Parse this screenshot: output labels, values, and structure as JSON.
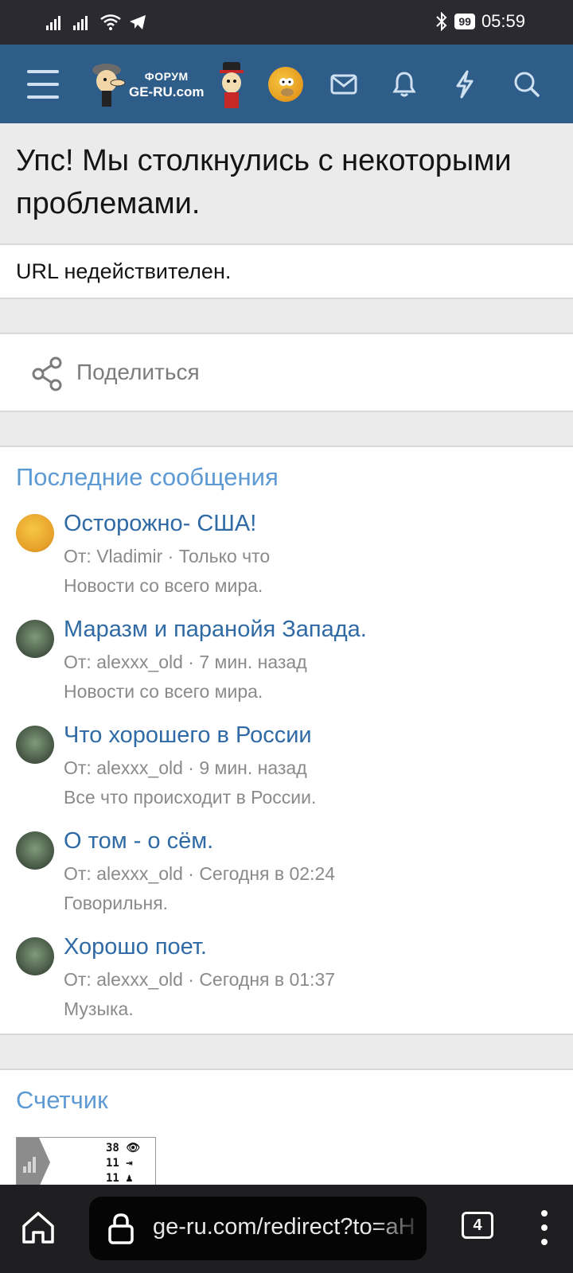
{
  "status_bar": {
    "battery": "99",
    "time": "05:59"
  },
  "header": {
    "logo_line1": "ФОРУМ",
    "logo_line2": "GE-RU.com"
  },
  "error": {
    "title": "Упс! Мы столкнулись с некоторыми проблемами.",
    "message": "URL недействителен."
  },
  "share": {
    "label": "Поделиться"
  },
  "recent": {
    "title": "Последние сообщения",
    "posts": [
      {
        "title": "Осторожно- США!",
        "meta": "От: Vladimir · Только что",
        "forum": "Новости со всего мира.",
        "avatar": "homer"
      },
      {
        "title": "Маразм и паранойя Запада.",
        "meta": "От: alexxx_old · 7 мин. назад",
        "forum": "Новости со всего мира.",
        "avatar": "old"
      },
      {
        "title": "Что хорошего в России",
        "meta": "От: alexxx_old · 9 мин. назад",
        "forum": "Все что происходит в России.",
        "avatar": "old"
      },
      {
        "title": "О том - о сём.",
        "meta": "От: alexxx_old · Сегодня в 02:24",
        "forum": "Говорильня.",
        "avatar": "old"
      },
      {
        "title": "Хорошо поет.",
        "meta": "От: alexxx_old · Сегодня в 01:37",
        "forum": "Музыка.",
        "avatar": "old"
      }
    ]
  },
  "counter": {
    "title": "Счетчик",
    "views": "38",
    "visits": "11",
    "visitors": "11"
  },
  "browser": {
    "url": "ge-ru.com/redirect?to=aH",
    "tab_count": "4"
  },
  "colors": {
    "header_bg": "#2f5d8a",
    "link": "#2f6aa5",
    "section_title": "#5d9ad4"
  }
}
